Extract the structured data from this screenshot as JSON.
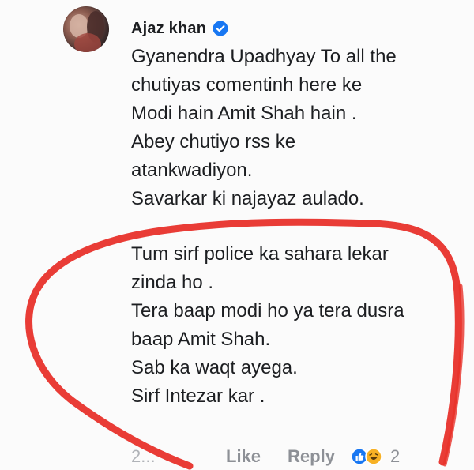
{
  "comment": {
    "author": "Ajaz khan",
    "paragraphs": [
      {
        "lines": [
          "Gyanendra Upadhyay  To all the",
          "chutiyas comentinh here ke",
          "Modi hain Amit Shah hain .",
          "Abey chutiyo rss ke",
          "atankwadiyon.",
          "Savarkar ki najayaz aulado."
        ]
      },
      {
        "lines": [
          "Tum sirf police ka sahara lekar",
          "zinda ho .",
          "Tera baap modi ho ya tera dusra",
          "baap Amit Shah.",
          "Sab ka waqt ayega.",
          "Sirf Intezar kar ."
        ]
      }
    ],
    "actions": {
      "time": "2...",
      "like_label": "Like",
      "reply_label": "Reply",
      "reaction_count": "2"
    }
  },
  "icons": {
    "verified": "verified-badge-icon",
    "like_reaction": "like-reaction-icon",
    "haha_reaction": "haha-reaction-icon"
  },
  "colors": {
    "verified_blue": "#1877f2",
    "annotation_red": "#e8322b",
    "action_gray": "#8d9096"
  }
}
